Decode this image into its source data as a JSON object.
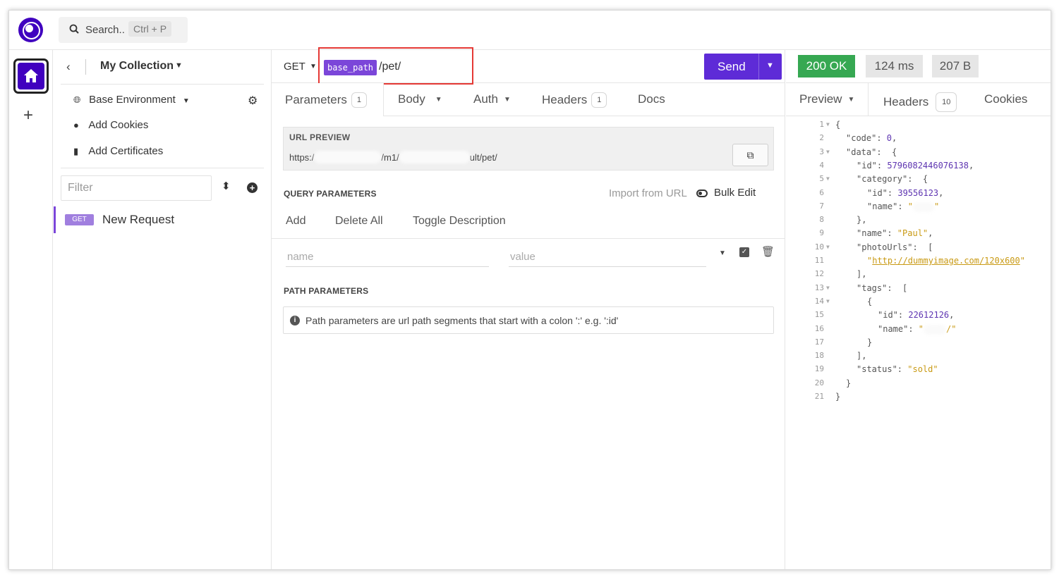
{
  "header": {
    "search_label": "Search..",
    "search_shortcut": "Ctrl + P"
  },
  "rail": {
    "add_label": "+"
  },
  "sidebar": {
    "collection_title": "My Collection",
    "items": [
      {
        "label": "Base Environment"
      },
      {
        "label": "Add Cookies"
      },
      {
        "label": "Add Certificates"
      }
    ],
    "filter_placeholder": "Filter",
    "requests": [
      {
        "method": "GET",
        "name": "New Request"
      }
    ]
  },
  "request": {
    "method": "GET",
    "url_variable": "base_path",
    "url_path": "/pet/",
    "send_label": "Send",
    "tabs": [
      {
        "label": "Parameters",
        "count": "1"
      },
      {
        "label": "Body"
      },
      {
        "label": "Auth"
      },
      {
        "label": "Headers",
        "count": "1"
      },
      {
        "label": "Docs"
      }
    ],
    "url_preview": {
      "label": "URL PREVIEW",
      "prefix": "https:/",
      "mid1": "/m1/",
      "suffix": "ult/pet/"
    },
    "query": {
      "label": "QUERY PARAMETERS",
      "import_label": "Import from URL",
      "bulk_edit_label": "Bulk Edit",
      "actions": [
        "Add",
        "Delete All",
        "Toggle Description"
      ],
      "name_placeholder": "name",
      "value_placeholder": "value"
    },
    "path": {
      "label": "PATH PARAMETERS",
      "info": "Path parameters are url path segments that start with a colon ':' e.g. ':id'"
    }
  },
  "response": {
    "status": "200 OK",
    "time": "124 ms",
    "size": "207 B",
    "tabs": [
      {
        "label": "Preview"
      },
      {
        "label": "Headers",
        "count": "10"
      },
      {
        "label": "Cookies"
      }
    ],
    "code_lines": [
      {
        "n": "1",
        "fold": true
      },
      {
        "n": "2",
        "key": "\"code\"",
        "val": "0",
        "type": "num",
        "comma": true
      },
      {
        "n": "3",
        "fold": true,
        "key": "\"data\""
      },
      {
        "n": "4",
        "key": "\"id\"",
        "val": "5796082446076138",
        "type": "num",
        "comma": true
      },
      {
        "n": "5",
        "fold": true,
        "key": "\"category\""
      },
      {
        "n": "6",
        "key": "\"id\"",
        "val": "39556123",
        "type": "num",
        "comma": true
      },
      {
        "n": "7",
        "key": "\"name\"",
        "val": "\"",
        "type": "str"
      },
      {
        "n": "8"
      },
      {
        "n": "9",
        "key": "\"name\"",
        "val": "\"Paul\"",
        "type": "str",
        "comma": true
      },
      {
        "n": "10",
        "fold": true,
        "key": "\"photoUrls\""
      },
      {
        "n": "11",
        "val": "http://dummyimage.com/120x600",
        "type": "link"
      },
      {
        "n": "12"
      },
      {
        "n": "13",
        "fold": true,
        "key": "\"tags\""
      },
      {
        "n": "14",
        "fold": true
      },
      {
        "n": "15",
        "key": "\"id\"",
        "val": "22612126",
        "type": "num",
        "comma": true
      },
      {
        "n": "16",
        "key": "\"name\"",
        "val": "/\"",
        "type": "str"
      },
      {
        "n": "17"
      },
      {
        "n": "18"
      },
      {
        "n": "19",
        "key": "\"status\"",
        "val": "\"sold\"",
        "type": "str"
      },
      {
        "n": "20"
      },
      {
        "n": "21"
      }
    ]
  }
}
